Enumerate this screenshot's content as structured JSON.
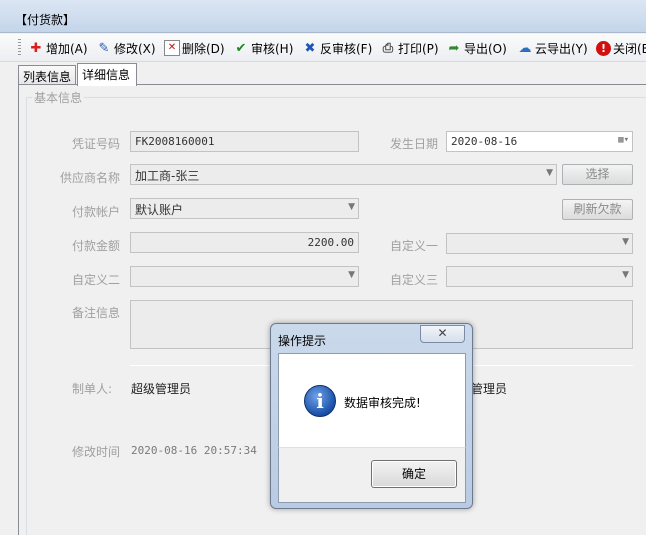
{
  "window": {
    "title": "【付货款】"
  },
  "toolbar": {
    "buttons": [
      {
        "label": "增加(A)",
        "icon": "plus-icon",
        "color": "#d92020"
      },
      {
        "label": "修改(X)",
        "icon": "edit-icon",
        "color": "#2a5aa8"
      },
      {
        "label": "删除(D)",
        "icon": "delete-icon",
        "color": "#c01010"
      },
      {
        "label": "审核(H)",
        "icon": "check-icon",
        "color": "#1b8a1b"
      },
      {
        "label": "反审核(F)",
        "icon": "unaudit-icon",
        "color": "#1d56b8"
      },
      {
        "label": "打印(P)",
        "icon": "printer-icon",
        "color": "#555555"
      },
      {
        "label": "导出(O)",
        "icon": "export-icon",
        "color": "#2f8a2f"
      },
      {
        "label": "云导出(Y)",
        "icon": "cloud-icon",
        "color": "#2a6fc4"
      },
      {
        "label": "关闭(E",
        "icon": "close-circle-icon",
        "color": "#d31010"
      }
    ]
  },
  "tabs": [
    {
      "label": "列表信息"
    },
    {
      "label": "详细信息"
    }
  ],
  "form": {
    "group_title": "基本信息",
    "voucher_label": "凭证号码",
    "voucher_value": "FK2008160001",
    "date_label": "发生日期",
    "date_value": "2020-08-16",
    "supplier_label": "供应商名称",
    "supplier_value": "加工商-张三",
    "select_button": "选择",
    "account_label": "付款帐户",
    "account_value": "默认账户",
    "refresh_button": "刷新欠款",
    "amount_label": "付款金额",
    "amount_value": "2200.00",
    "custom1_label": "自定义一",
    "custom2_label": "自定义二",
    "custom3_label": "自定义三",
    "remark_label": "备注信息",
    "creator_label": "制单人:",
    "creator_value": "超级管理员",
    "auditor_value": "管理员",
    "modified_label": "修改时间",
    "modified_value": "2020-08-16 20:57:34"
  },
  "dialog": {
    "title": "操作提示",
    "close_glyph": "✕",
    "message": "数据审核完成!",
    "ok_button": "确定"
  }
}
